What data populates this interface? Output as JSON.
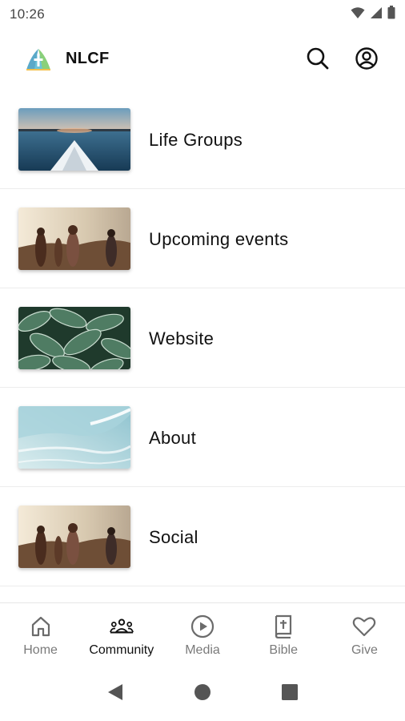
{
  "status_bar": {
    "time": "10:26"
  },
  "app_bar": {
    "title": "NLCF"
  },
  "list_items": [
    {
      "label": "Life Groups",
      "thumb": "lake-canoe-image"
    },
    {
      "label": "Upcoming events",
      "thumb": "friends-sunset-image"
    },
    {
      "label": "Website",
      "thumb": "green-leaves-image"
    },
    {
      "label": "About",
      "thumb": "ocean-wave-image"
    },
    {
      "label": "Social",
      "thumb": "friends-sunset-image"
    }
  ],
  "bottom_nav": [
    {
      "label": "Home",
      "icon": "home-icon",
      "active": false
    },
    {
      "label": "Community",
      "icon": "community-icon",
      "active": true
    },
    {
      "label": "Media",
      "icon": "play-circle-icon",
      "active": false
    },
    {
      "label": "Bible",
      "icon": "bible-icon",
      "active": false
    },
    {
      "label": "Give",
      "icon": "heart-icon",
      "active": false
    }
  ],
  "colors": {
    "text": "#111111",
    "nav_inactive": "#7a7a7a",
    "divider": "#ececec"
  }
}
